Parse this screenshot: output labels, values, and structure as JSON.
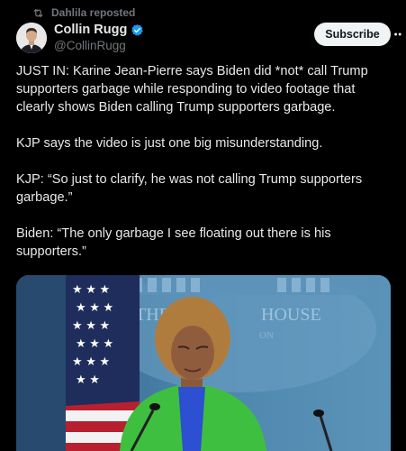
{
  "repost": {
    "label": "Dahlila reposted",
    "icon": "repost-icon"
  },
  "author": {
    "display_name": "Collin Rugg",
    "handle": "@CollinRugg",
    "verified": true,
    "verified_color": "#1d9bf0"
  },
  "actions": {
    "subscribe_label": "Subscribe",
    "more_icon": "more-icon"
  },
  "tweet": {
    "paragraphs": [
      "JUST IN: Karine Jean-Pierre says Biden did *not* call Trump supporters garbage while responding to video footage that clearly shows Biden calling Trump supporters garbage.",
      "KJP says the video is just one big misunderstanding.",
      "KJP: “So just to clarify, he was not calling Trump supporters garbage.”",
      "Biden: “The only garbage I see floating out there is his supporters.”"
    ]
  },
  "media": {
    "seal_text_left": "THE",
    "seal_text_right": "HOUSE",
    "seal_text_small": "ON"
  },
  "colors": {
    "background": "#000000",
    "text": "#e7e9ea",
    "secondary_text": "#71767b",
    "button_bg": "#eff3f4"
  }
}
